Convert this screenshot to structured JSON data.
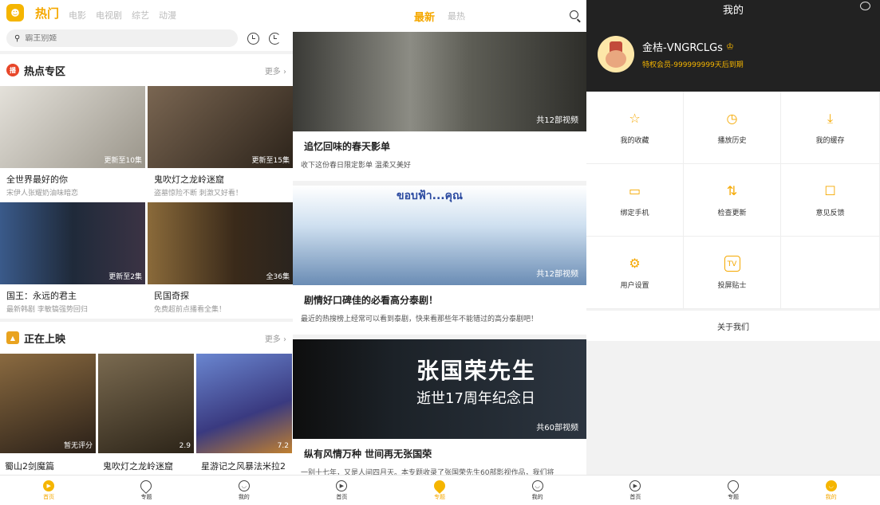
{
  "panel1": {
    "logo_glyph": "☻",
    "tabs": [
      {
        "label": "热门",
        "active": true
      },
      {
        "label": "电影",
        "active": false
      },
      {
        "label": "电视剧",
        "active": false
      },
      {
        "label": "综艺",
        "active": false
      },
      {
        "label": "动漫",
        "active": false
      }
    ],
    "search_placeholder": "霸王别姬",
    "hot": {
      "badge": "播",
      "title": "热点专区",
      "more": "更多 ›",
      "cards": [
        {
          "badge": "更新至10集",
          "title": "全世界最好的你",
          "subtitle": "宋伊人张耀奶油味暗恋",
          "bg": "#c9c6c0"
        },
        {
          "badge": "更新至15集",
          "title": "鬼吹灯之龙岭迷窟",
          "subtitle": "盗墓惊险不断 刺激又好看！",
          "bg": "#5a4a3a"
        },
        {
          "badge": "更新至2集",
          "title": "国王：永远的君主",
          "subtitle": "最新韩剧 李敏镐强势回归",
          "bg": "#2d3d55"
        },
        {
          "badge": "全36集",
          "title": "民国奇探",
          "subtitle": "免费超前点播看全集！",
          "bg": "#6a4e2e"
        }
      ]
    },
    "now": {
      "title": "正在上映",
      "more": "更多 ›",
      "cards": [
        {
          "score": "暂无评分",
          "title": "蜀山2剑魔篇",
          "bg": "#3b3024"
        },
        {
          "score": "2.9",
          "title": "鬼吹灯之龙岭迷窟",
          "bg": "#4a3c2a"
        },
        {
          "score": "7.2",
          "title": "星游记之风暴法米拉2",
          "bg": "#4c5aa0"
        }
      ]
    },
    "nav": [
      {
        "label": "首页",
        "active": true
      },
      {
        "label": "专题",
        "active": false
      },
      {
        "label": "我的",
        "active": false
      }
    ]
  },
  "panel2": {
    "tabs": [
      {
        "label": "最新",
        "active": true
      },
      {
        "label": "最热",
        "active": false
      }
    ],
    "topics": [
      {
        "count": "共12部视频",
        "title": "追忆回味的春天影单",
        "desc": "收下这份春日限定影单 温柔又美好",
        "bg": "#6e6e66"
      },
      {
        "count": "共12部视频",
        "title": "剧情好口碑佳的必看高分泰剧！",
        "desc": "最近的热搜榜上经常可以看到泰剧，快来看那些年不能错过的高分泰剧吧！",
        "bg": "#9fb9d4",
        "banner_text": "ขอบฟ้า...คุณ"
      },
      {
        "count": "共60部视频",
        "title": "纵有风情万种 世间再无张国荣",
        "desc": "一别十七年，又是人间四月天。本专题收录了张国荣先生60部影视作品，我们将",
        "bg": "#2a3340",
        "banner_big": "张国荣先生",
        "banner_line": "逝世17周年纪念日"
      }
    ],
    "nav": [
      {
        "label": "首页",
        "active": false
      },
      {
        "label": "专题",
        "active": true
      },
      {
        "label": "我的",
        "active": false
      }
    ]
  },
  "panel3": {
    "title": "我的",
    "name": "金桔-VNGRCLGs",
    "vip": "特权会员-999999999天后到期",
    "menu": [
      {
        "icon": "☆",
        "label": "我的收藏"
      },
      {
        "icon": "◷",
        "label": "播放历史"
      },
      {
        "icon": "⤓",
        "label": "我的缓存"
      },
      {
        "icon": "▭",
        "label": "绑定手机"
      },
      {
        "icon": "⇅",
        "label": "检查更新"
      },
      {
        "icon": "☐",
        "label": "意见反馈"
      },
      {
        "icon": "⚙",
        "label": "用户设置"
      },
      {
        "icon": "TV",
        "label": "投屏贴士"
      },
      {
        "icon": "",
        "label": ""
      }
    ],
    "about": "关于我们",
    "nav": [
      {
        "label": "首页",
        "active": false
      },
      {
        "label": "专题",
        "active": false
      },
      {
        "label": "我的",
        "active": true
      }
    ]
  }
}
